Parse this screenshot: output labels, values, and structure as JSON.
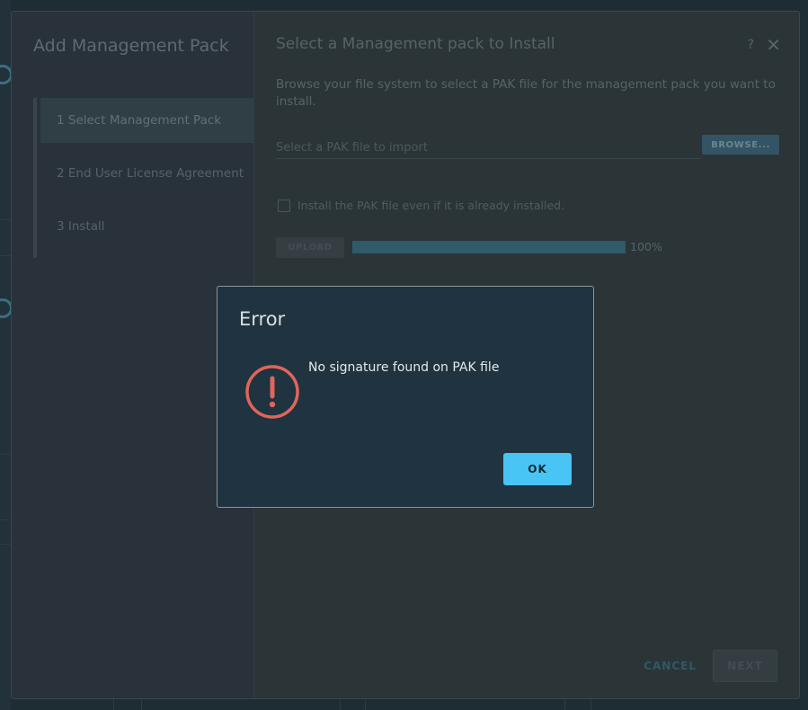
{
  "wizard": {
    "title": "Add Management Pack",
    "steps": [
      {
        "label": "1  Select Management Pack",
        "active": true
      },
      {
        "label": "2  End User License Agreement",
        "active": false
      },
      {
        "label": "3  Install",
        "active": false
      }
    ],
    "main_title": "Select a Management pack to Install",
    "help_label": "?",
    "close_label": "✕",
    "description": "Browse your file system to select a PAK file for the management pack you want to install.",
    "file_input": {
      "placeholder": "Select a PAK file to import",
      "value": ""
    },
    "browse_label": "BROWSE...",
    "checkbox_label": "Install the PAK file even if it is already installed.",
    "checkbox_checked": false,
    "upload_label": "UPLOAD",
    "progress": {
      "percent": 100,
      "label": "100%"
    },
    "cancel_label": "CANCEL",
    "next_label": "NEXT"
  },
  "error_dialog": {
    "title": "Error",
    "message": "No signature found on PAK file",
    "icon": "exclamation-circle-icon",
    "ok_label": "OK"
  },
  "colors": {
    "error_icon": "#e0655a",
    "primary_button": "#49c5f5",
    "dialog_background": "#1f3340",
    "wizard_background": "#2b3538"
  }
}
